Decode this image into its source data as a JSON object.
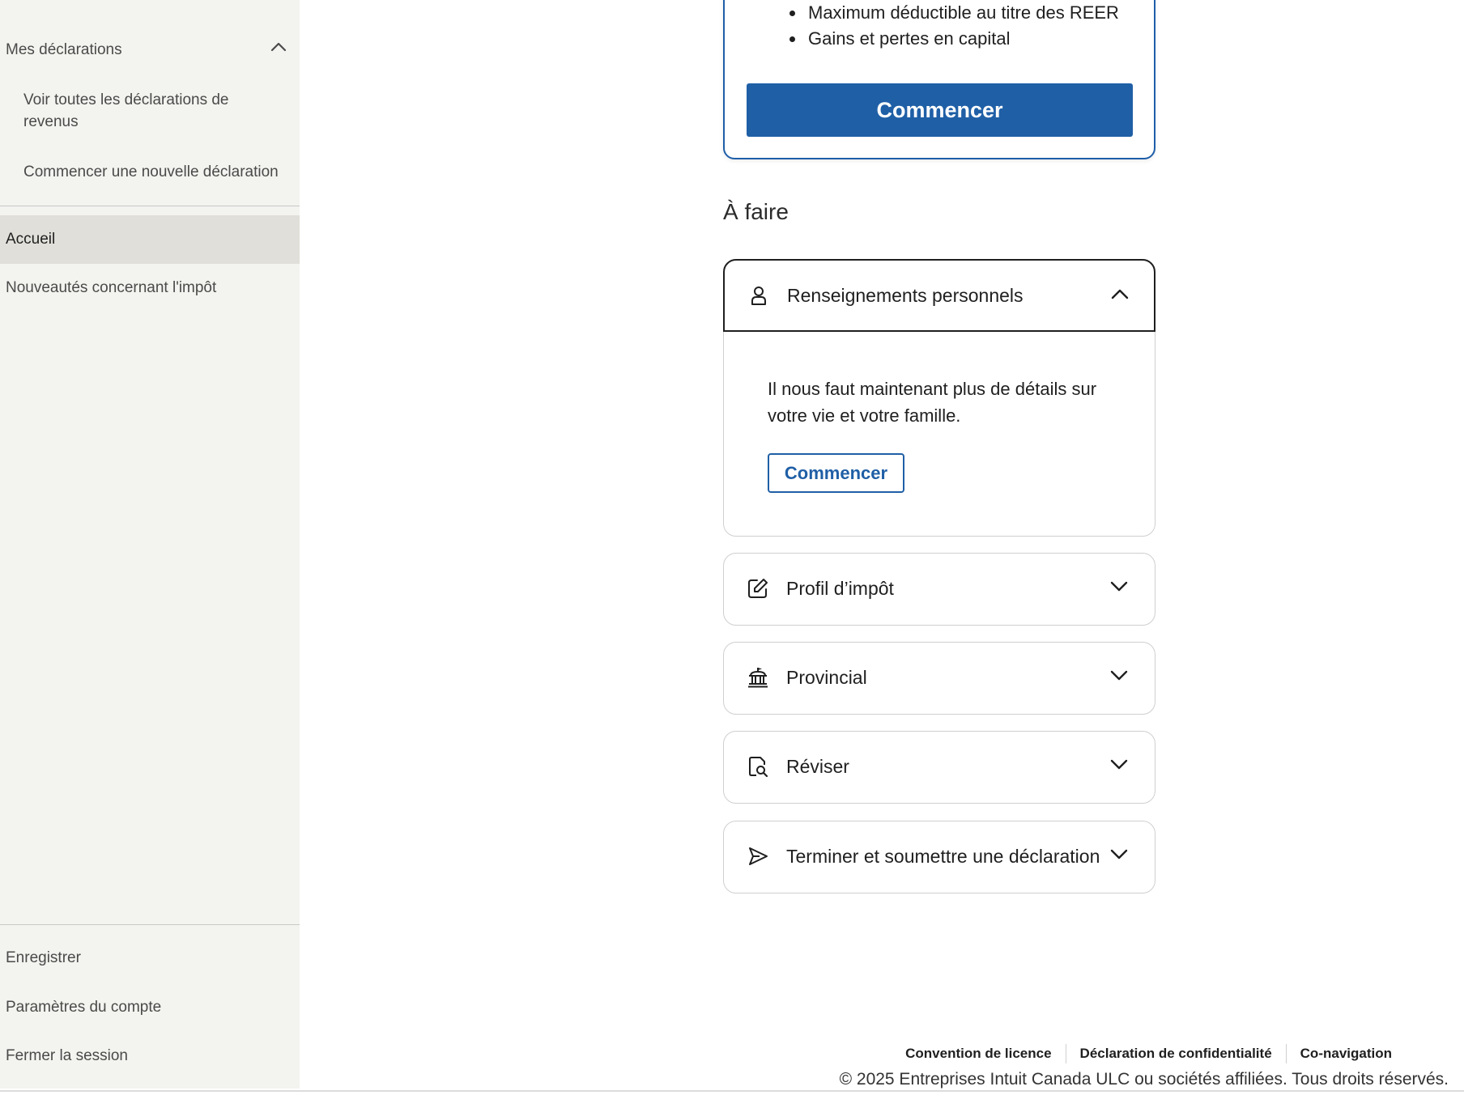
{
  "sidebar": {
    "group_label": "Mes déclarations",
    "sub_items": [
      "Voir toutes les déclarations de revenus",
      "Commencer une nouvelle déclaration"
    ],
    "items": [
      "Accueil",
      "Nouveautés concernant l'impôt"
    ],
    "bottom_items": [
      "Enregistrer",
      "Paramètres du compte",
      "Fermer la session"
    ]
  },
  "top_card": {
    "bullets": [
      "Maximum déductible au titre des REER",
      "Gains et pertes en capital"
    ],
    "button_label": "Commencer"
  },
  "todo": {
    "title": "À faire",
    "accordions": [
      {
        "label": "Renseignements personnels",
        "icon": "person-icon",
        "expanded": true,
        "body_text": "Il nous faut maintenant plus de détails sur votre vie et votre famille.",
        "button_label": "Commencer"
      },
      {
        "label": "Profil d’impôt",
        "icon": "edit-icon",
        "expanded": false
      },
      {
        "label": "Provincial",
        "icon": "government-building-icon",
        "expanded": false
      },
      {
        "label": "Réviser",
        "icon": "document-search-icon",
        "expanded": false
      },
      {
        "label": "Terminer et soumettre une déclaration",
        "icon": "send-icon",
        "expanded": false
      }
    ]
  },
  "footer": {
    "links": [
      "Convention de licence",
      "Déclaration de confidentialité",
      "Co-navigation"
    ],
    "copyright": "© 2025 Entreprises Intuit Canada ULC ou sociétés affiliées. Tous droits réservés."
  },
  "colors": {
    "primary": "#1f5fa6",
    "sidebar_bg": "#f3f3ef",
    "sidebar_active": "#e0dfd9"
  }
}
